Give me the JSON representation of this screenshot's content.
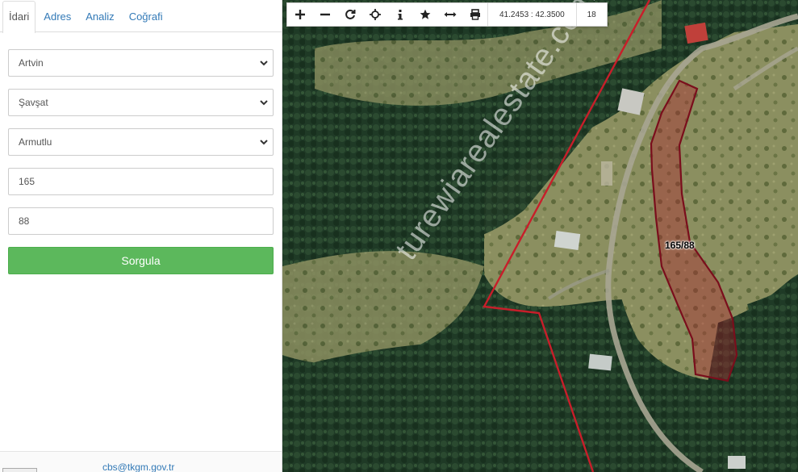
{
  "tabs": [
    {
      "label": "İdari",
      "active": true
    },
    {
      "label": "Adres",
      "active": false
    },
    {
      "label": "Analiz",
      "active": false
    },
    {
      "label": "Coğrafi",
      "active": false
    }
  ],
  "form": {
    "province": "Artvin",
    "district": "Şavşat",
    "neighborhood": "Armutlu",
    "block": "165",
    "parcel": "88",
    "submit_label": "Sorgula"
  },
  "footer": {
    "email": "cbs@tkgm.gov.tr"
  },
  "toolbar": {
    "buttons": [
      "zoom-in-icon",
      "zoom-out-icon",
      "refresh-icon",
      "locate-icon",
      "info-icon",
      "bookmark-icon",
      "measure-icon",
      "print-icon"
    ],
    "coordinates": "41.2453 : 42.3500",
    "zoom_level": "18"
  },
  "map": {
    "parcel_label": "165/88",
    "watermark": "turewiarealestate.com",
    "parcel_color": "#b0202e",
    "boundary_color": "#c81e2a"
  }
}
